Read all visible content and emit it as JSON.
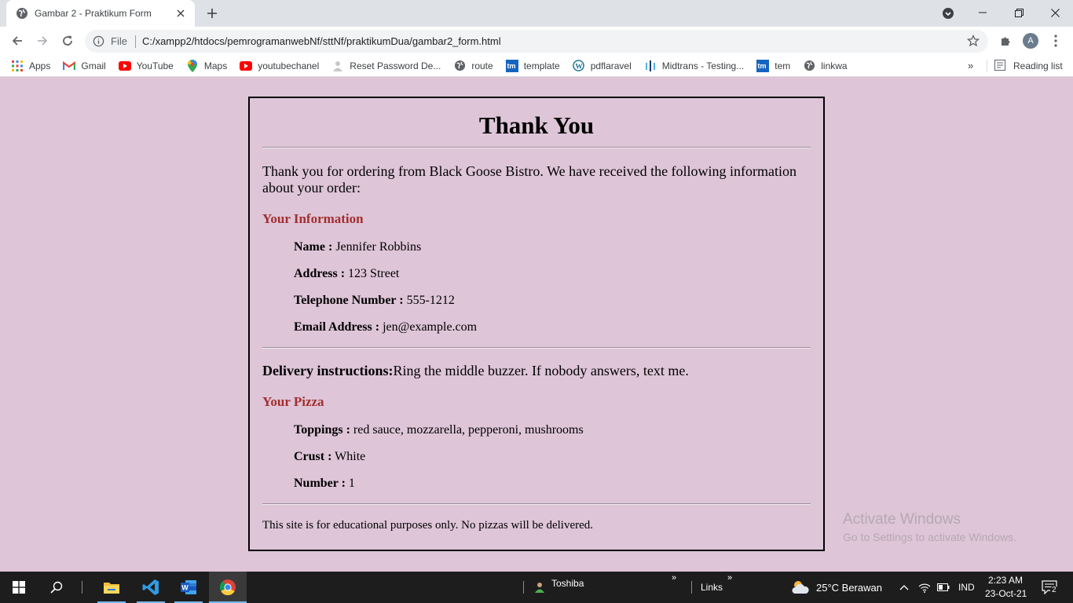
{
  "browser": {
    "tab_title": "Gambar 2 - Praktikum Form",
    "address": {
      "scheme_label": "File",
      "url": "C:/xampp2/htdocs/pemrogramanwebNf/sttNf/praktikumDua/gambar2_form.html"
    },
    "profile_initial": "A",
    "bookmarks": [
      {
        "label": "Apps",
        "icon": "apps-grid-icon"
      },
      {
        "label": "Gmail",
        "icon": "gmail-icon"
      },
      {
        "label": "YouTube",
        "icon": "youtube-icon"
      },
      {
        "label": "Maps",
        "icon": "maps-icon"
      },
      {
        "label": "youtubechanel",
        "icon": "youtube-icon"
      },
      {
        "label": "Reset Password De...",
        "icon": "page-icon"
      },
      {
        "label": "route",
        "icon": "globe-icon"
      },
      {
        "label": "template",
        "icon": "tm-icon"
      },
      {
        "label": "pdflaravel",
        "icon": "wordpress-icon"
      },
      {
        "label": "Midtrans - Testing...",
        "icon": "midtrans-icon"
      },
      {
        "label": "tem",
        "icon": "tm-icon"
      },
      {
        "label": "linkwa",
        "icon": "globe-icon"
      }
    ],
    "more_bookmarks": "»",
    "reading_list": "Reading list"
  },
  "page": {
    "title": "Thank You",
    "intro": "Thank you for ordering from Black Goose Bistro. We have received the following information about your order:",
    "info_heading": "Your Information",
    "info": [
      {
        "label": "Name :",
        "value": "Jennifer Robbins"
      },
      {
        "label": "Address :",
        "value": "123 Street"
      },
      {
        "label": "Telephone Number :",
        "value": "555-1212"
      },
      {
        "label": "Email Address :",
        "value": "jen@example.com"
      }
    ],
    "delivery_label": "Delivery instructions:",
    "delivery_value": "Ring the middle buzzer. If nobody answers, text me.",
    "pizza_heading": "Your Pizza",
    "pizza": [
      {
        "label": "Toppings :",
        "value": "red sauce, mozzarella, pepperoni, mushrooms"
      },
      {
        "label": "Crust :",
        "value": "White"
      },
      {
        "label": "Number :",
        "value": "1"
      }
    ],
    "footnote": "This site is for educational purposes only. No pizzas will be delivered."
  },
  "watermark": {
    "line1": "Activate Windows",
    "line2": "Go to Settings to activate Windows."
  },
  "taskbar": {
    "user": "Toshiba",
    "links": "Links",
    "weather": "25°C  Berawan",
    "language": "IND",
    "time": "2:23 AM",
    "date": "23-Oct-21",
    "notification_count": "2"
  },
  "colors": {
    "page_background": "#dec5d8",
    "section_heading": "#a12e2e",
    "taskbar": "#1d1d1d"
  }
}
